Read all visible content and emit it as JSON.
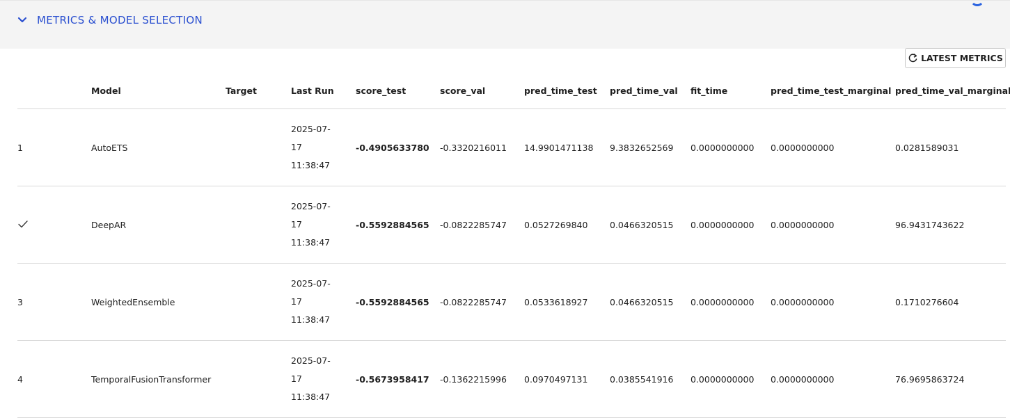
{
  "section": {
    "title": "METRICS & MODEL SELECTION",
    "chevron_icon": "chevron-down-icon",
    "accent_color": "#2a4fd0"
  },
  "toolbar": {
    "latest_metrics_label": "LATEST METRICS",
    "refresh_icon": "refresh-icon"
  },
  "table": {
    "headers": [
      "",
      "Model",
      "Target",
      "Last Run",
      "score_test",
      "score_val",
      "pred_time_test",
      "pred_time_val",
      "fit_time",
      "pred_time_test_marginal",
      "pred_time_val_marginal"
    ],
    "rows": [
      {
        "rank": "1",
        "selected": false,
        "model": "AutoETS",
        "target": "",
        "last_run": [
          "2025-07-",
          "17",
          "11:38:47"
        ],
        "score_test": "-0.4905633780",
        "score_val": "-0.3320216011",
        "pred_time_test": "14.9901471138",
        "pred_time_val": "9.3832652569",
        "fit_time": "0.0000000000",
        "pred_time_test_marginal": "0.0000000000",
        "pred_time_val_marginal": "0.0281589031"
      },
      {
        "rank": "",
        "selected": true,
        "model": "DeepAR",
        "target": "",
        "last_run": [
          "2025-07-",
          "17",
          "11:38:47"
        ],
        "score_test": "-0.5592884565",
        "score_val": "-0.0822285747",
        "pred_time_test": "0.0527269840",
        "pred_time_val": "0.0466320515",
        "fit_time": "0.0000000000",
        "pred_time_test_marginal": "0.0000000000",
        "pred_time_val_marginal": "96.9431743622"
      },
      {
        "rank": "3",
        "selected": false,
        "model": "WeightedEnsemble",
        "target": "",
        "last_run": [
          "2025-07-",
          "17",
          "11:38:47"
        ],
        "score_test": "-0.5592884565",
        "score_val": "-0.0822285747",
        "pred_time_test": "0.0533618927",
        "pred_time_val": "0.0466320515",
        "fit_time": "0.0000000000",
        "pred_time_test_marginal": "0.0000000000",
        "pred_time_val_marginal": "0.1710276604"
      },
      {
        "rank": "4",
        "selected": false,
        "model": "TemporalFusionTransformer",
        "target": "",
        "last_run": [
          "2025-07-",
          "17",
          "11:38:47"
        ],
        "score_test": "-0.5673958417",
        "score_val": "-0.1362215996",
        "pred_time_test": "0.0970497131",
        "pred_time_val": "0.0385541916",
        "fit_time": "0.0000000000",
        "pred_time_test_marginal": "0.0000000000",
        "pred_time_val_marginal": "76.9695863724"
      }
    ]
  }
}
